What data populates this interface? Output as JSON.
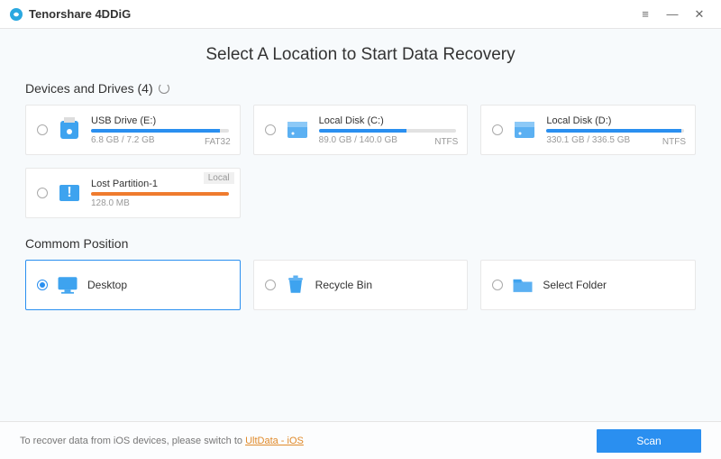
{
  "app_name": "Tenorshare 4DDiG",
  "heading": "Select A Location to Start Data Recovery",
  "sections": {
    "drives_label": "Devices and Drives (4)",
    "positions_label": "Commom Position"
  },
  "drives": [
    {
      "name": "USB Drive (E:)",
      "meta": "6.8 GB / 7.2 GB",
      "fs": "FAT32",
      "pct": 94,
      "color": "#2a8ff0",
      "icon": "usb",
      "tag": ""
    },
    {
      "name": "Local Disk (C:)",
      "meta": "89.0 GB / 140.0 GB",
      "fs": "NTFS",
      "pct": 64,
      "color": "#2a8ff0",
      "icon": "disk",
      "tag": ""
    },
    {
      "name": "Local Disk (D:)",
      "meta": "330.1 GB / 336.5 GB",
      "fs": "NTFS",
      "pct": 98,
      "color": "#2a8ff0",
      "icon": "disk",
      "tag": ""
    },
    {
      "name": "Lost Partition-1",
      "meta": "128.0 MB",
      "fs": "",
      "pct": 100,
      "color": "#ef7b2e",
      "icon": "lost",
      "tag": "Local"
    }
  ],
  "positions": [
    {
      "name": "Desktop",
      "icon": "desktop",
      "selected": true
    },
    {
      "name": "Recycle Bin",
      "icon": "recycle",
      "selected": false
    },
    {
      "name": "Select Folder",
      "icon": "folder",
      "selected": false
    }
  ],
  "footer": {
    "pre_text": "To recover data from iOS devices, please switch to ",
    "link_text": "UltData - iOS",
    "scan_label": "Scan"
  }
}
